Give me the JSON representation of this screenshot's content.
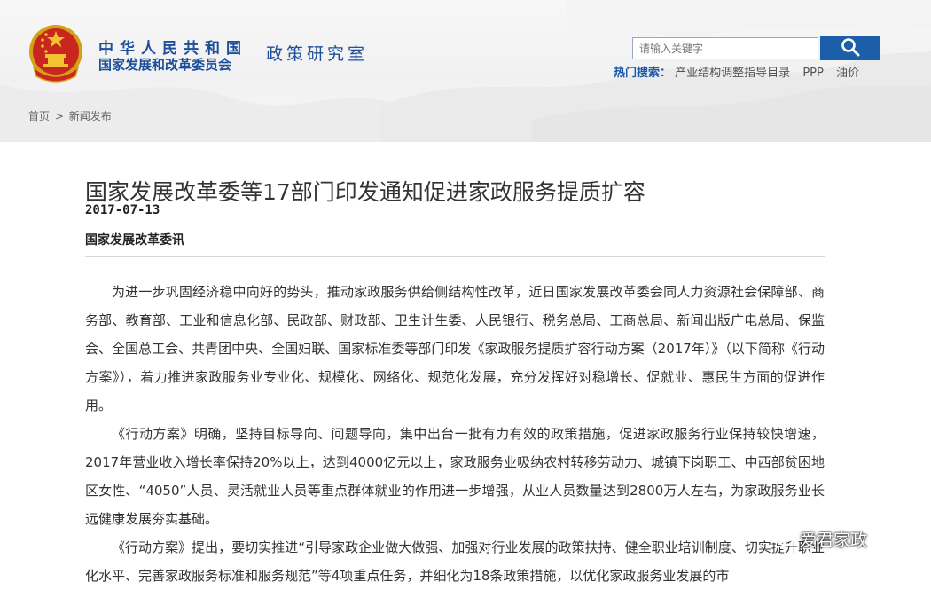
{
  "header": {
    "org_line1": "中华人民共和国",
    "org_line2": "国家发展和改革委员会",
    "department": "政策研究室",
    "emblem_icon": "national-emblem-icon",
    "accent_color": "#1e4f9a"
  },
  "search": {
    "placeholder": "请输入关键字",
    "button_icon": "search-icon",
    "button_color": "#1b5fa8",
    "hot_label": "热门搜索：",
    "hot_keywords": [
      "产业结构调整指导目录",
      "PPP",
      "油价"
    ]
  },
  "breadcrumb": {
    "home": "首页",
    "separator": ">",
    "current": "新闻发布"
  },
  "article": {
    "title": "国家发展改革委等17部门印发通知促进家政服务提质扩容",
    "date": "2017-07-13",
    "source": "国家发展改革委讯",
    "paragraphs": [
      "为进一步巩固经济稳中向好的势头，推动家政服务供给侧结构性改革，近日国家发展改革委会同人力资源社会保障部、商务部、教育部、工业和信息化部、民政部、财政部、卫生计生委、人民银行、税务总局、工商总局、新闻出版广电总局、保监会、全国总工会、共青团中央、全国妇联、国家标准委等部门印发《家政服务提质扩容行动方案（2017年）》（以下简称《行动方案》），着力推进家政服务业专业化、规模化、网络化、规范化发展，充分发挥好对稳增长、促就业、惠民生方面的促进作用。",
      "《行动方案》明确，坚持目标导向、问题导向，集中出台一批有力有效的政策措施，促进家政服务行业保持较快增速，2017年营业收入增长率保持20%以上，达到4000亿元以上，家政服务业吸纳农村转移劳动力、城镇下岗职工、中西部贫困地区女性、“4050”人员、灵活就业人员等重点群体就业的作用进一步增强，从业人员数量达到2800万人左右，为家政服务业长远健康发展夯实基础。",
      "《行动方案》提出，要切实推进“引导家政企业做大做强、加强对行业发展的政策扶持、健全职业培训制度、切实提升职业化水平、完善家政服务标准和服务规范”等4项重点任务，并细化为18条政策措施，以优化家政服务业发展的市"
    ]
  },
  "watermark": {
    "icon": "wechat-icon",
    "text": "爱君家政"
  }
}
